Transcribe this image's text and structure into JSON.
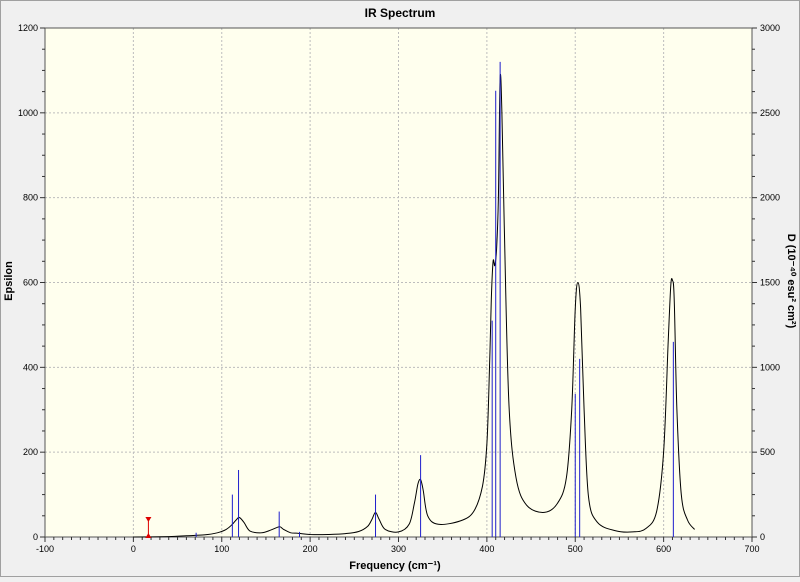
{
  "window": {
    "title": "IR Spectrum",
    "border_color": "#a0a0a0",
    "title_bg": "#f0f0f0"
  },
  "colors": {
    "plot_bg": "#ffffee",
    "grid": "#bdbdbd",
    "curve": "#000000",
    "sticks": "#1e1ecc",
    "marker": "#dd0000"
  },
  "chart_data": {
    "type": "line",
    "title": "IR Spectrum",
    "xlabel": "Frequency (cm⁻¹)",
    "ylabel_left": "Epsilon",
    "ylabel_right": "D (10⁻⁴⁰ esu² cm²)",
    "xlim": [
      -100,
      700
    ],
    "ylim_left": [
      0,
      1200
    ],
    "ylim_right": [
      0,
      3000
    ],
    "x_ticks": [
      -100,
      0,
      100,
      200,
      300,
      400,
      500,
      600,
      700
    ],
    "y_ticks_left": [
      0,
      200,
      400,
      600,
      800,
      1000,
      1200
    ],
    "y_ticks_right": [
      0,
      500,
      1000,
      1500,
      2000,
      2500,
      3000
    ],
    "grid": true,
    "series": [
      {
        "x": [
          0,
          40,
          60,
          80,
          95,
          105,
          112,
          117,
          120,
          125,
          132,
          145,
          155,
          162,
          166,
          170,
          178,
          186,
          190,
          200,
          220,
          240,
          255,
          265,
          270,
          274,
          278,
          285,
          300,
          312,
          318,
          322,
          325,
          328,
          333,
          345,
          370,
          385,
          395,
          400,
          403,
          405,
          407,
          409,
          411,
          413,
          415,
          417,
          420,
          425,
          433,
          445,
          465,
          480,
          490,
          496,
          500,
          503,
          506,
          510,
          515,
          525,
          545,
          565,
          580,
          592,
          600,
          605,
          608,
          610,
          612,
          615,
          620,
          627,
          635
        ],
        "y": [
          0,
          1,
          3,
          5,
          10,
          18,
          30,
          42,
          46,
          35,
          14,
          10,
          16,
          22,
          24,
          18,
          10,
          9,
          8,
          6,
          6,
          8,
          13,
          25,
          42,
          58,
          42,
          18,
          12,
          30,
          80,
          125,
          135,
          110,
          50,
          30,
          38,
          60,
          120,
          220,
          400,
          560,
          650,
          640,
          680,
          800,
          1080,
          1000,
          700,
          310,
          140,
          75,
          58,
          80,
          140,
          300,
          540,
          600,
          540,
          300,
          95,
          35,
          15,
          12,
          20,
          60,
          200,
          450,
          590,
          605,
          560,
          300,
          100,
          40,
          18
        ]
      }
    ],
    "sticks": {
      "x": [
        71,
        112,
        119,
        165,
        188,
        274,
        325,
        406,
        410,
        415,
        500,
        505,
        611
      ],
      "y": [
        10,
        100,
        158,
        60,
        12,
        100,
        193,
        510,
        1052,
        1120,
        337,
        420,
        460
      ]
    },
    "marker_x": 17
  }
}
